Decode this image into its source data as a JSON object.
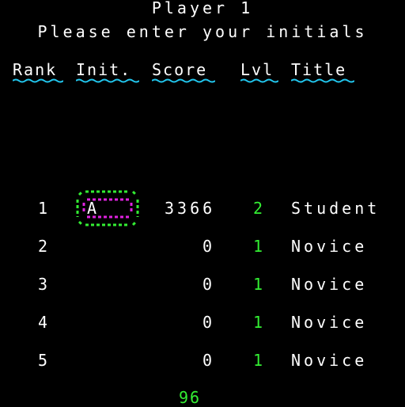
{
  "header": {
    "player_label": "Player 1",
    "prompt": "Please enter your initials"
  },
  "columns": {
    "rank": "Rank",
    "initials": "Init.",
    "score": "Score",
    "level": "Lvl",
    "title": "Title"
  },
  "rows": [
    {
      "rank": "1",
      "initials": "A",
      "score": "3366",
      "level": "2",
      "title": "Student"
    },
    {
      "rank": "2",
      "initials": "",
      "score": "0",
      "level": "1",
      "title": "Novice"
    },
    {
      "rank": "3",
      "initials": "",
      "score": "0",
      "level": "1",
      "title": "Novice"
    },
    {
      "rank": "4",
      "initials": "",
      "score": "0",
      "level": "1",
      "title": "Novice"
    },
    {
      "rank": "5",
      "initials": "",
      "score": "0",
      "level": "1",
      "title": "Novice"
    }
  ],
  "timer": "96",
  "colors": {
    "text": "#ffffff",
    "accent_green": "#33ee33",
    "underline_cyan": "#22c8f0",
    "cursor_magenta": "#e022e0",
    "background": "#000000"
  }
}
